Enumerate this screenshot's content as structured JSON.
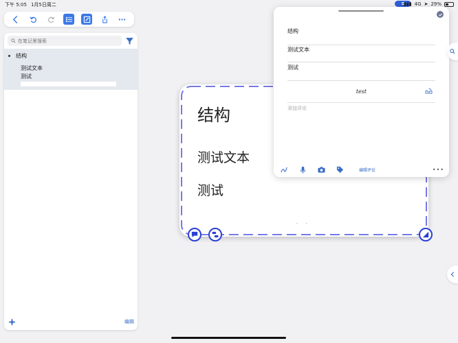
{
  "status_bar": {
    "time": "下午 5:05",
    "date": "1月5日周二",
    "network": "4G",
    "battery": "29%"
  },
  "sidebar": {
    "search_placeholder": "在笔记里搜索",
    "outline": {
      "root": "结构",
      "children": [
        "测试文本",
        "测试"
      ]
    },
    "edit_label": "编辑"
  },
  "card": {
    "title": "结构",
    "line1": "测试文本",
    "line2": "测试"
  },
  "popover": {
    "title": "结构",
    "row1": "测试文本",
    "row2": "测试",
    "test_text": "test",
    "comment_placeholder": "添加评论",
    "edit_comment_label": "编辑评论"
  },
  "colors": {
    "accent": "#3a78e6",
    "dash": "#7777e8",
    "card_button": "#2a3fd6",
    "link": "#3a6ec7"
  }
}
